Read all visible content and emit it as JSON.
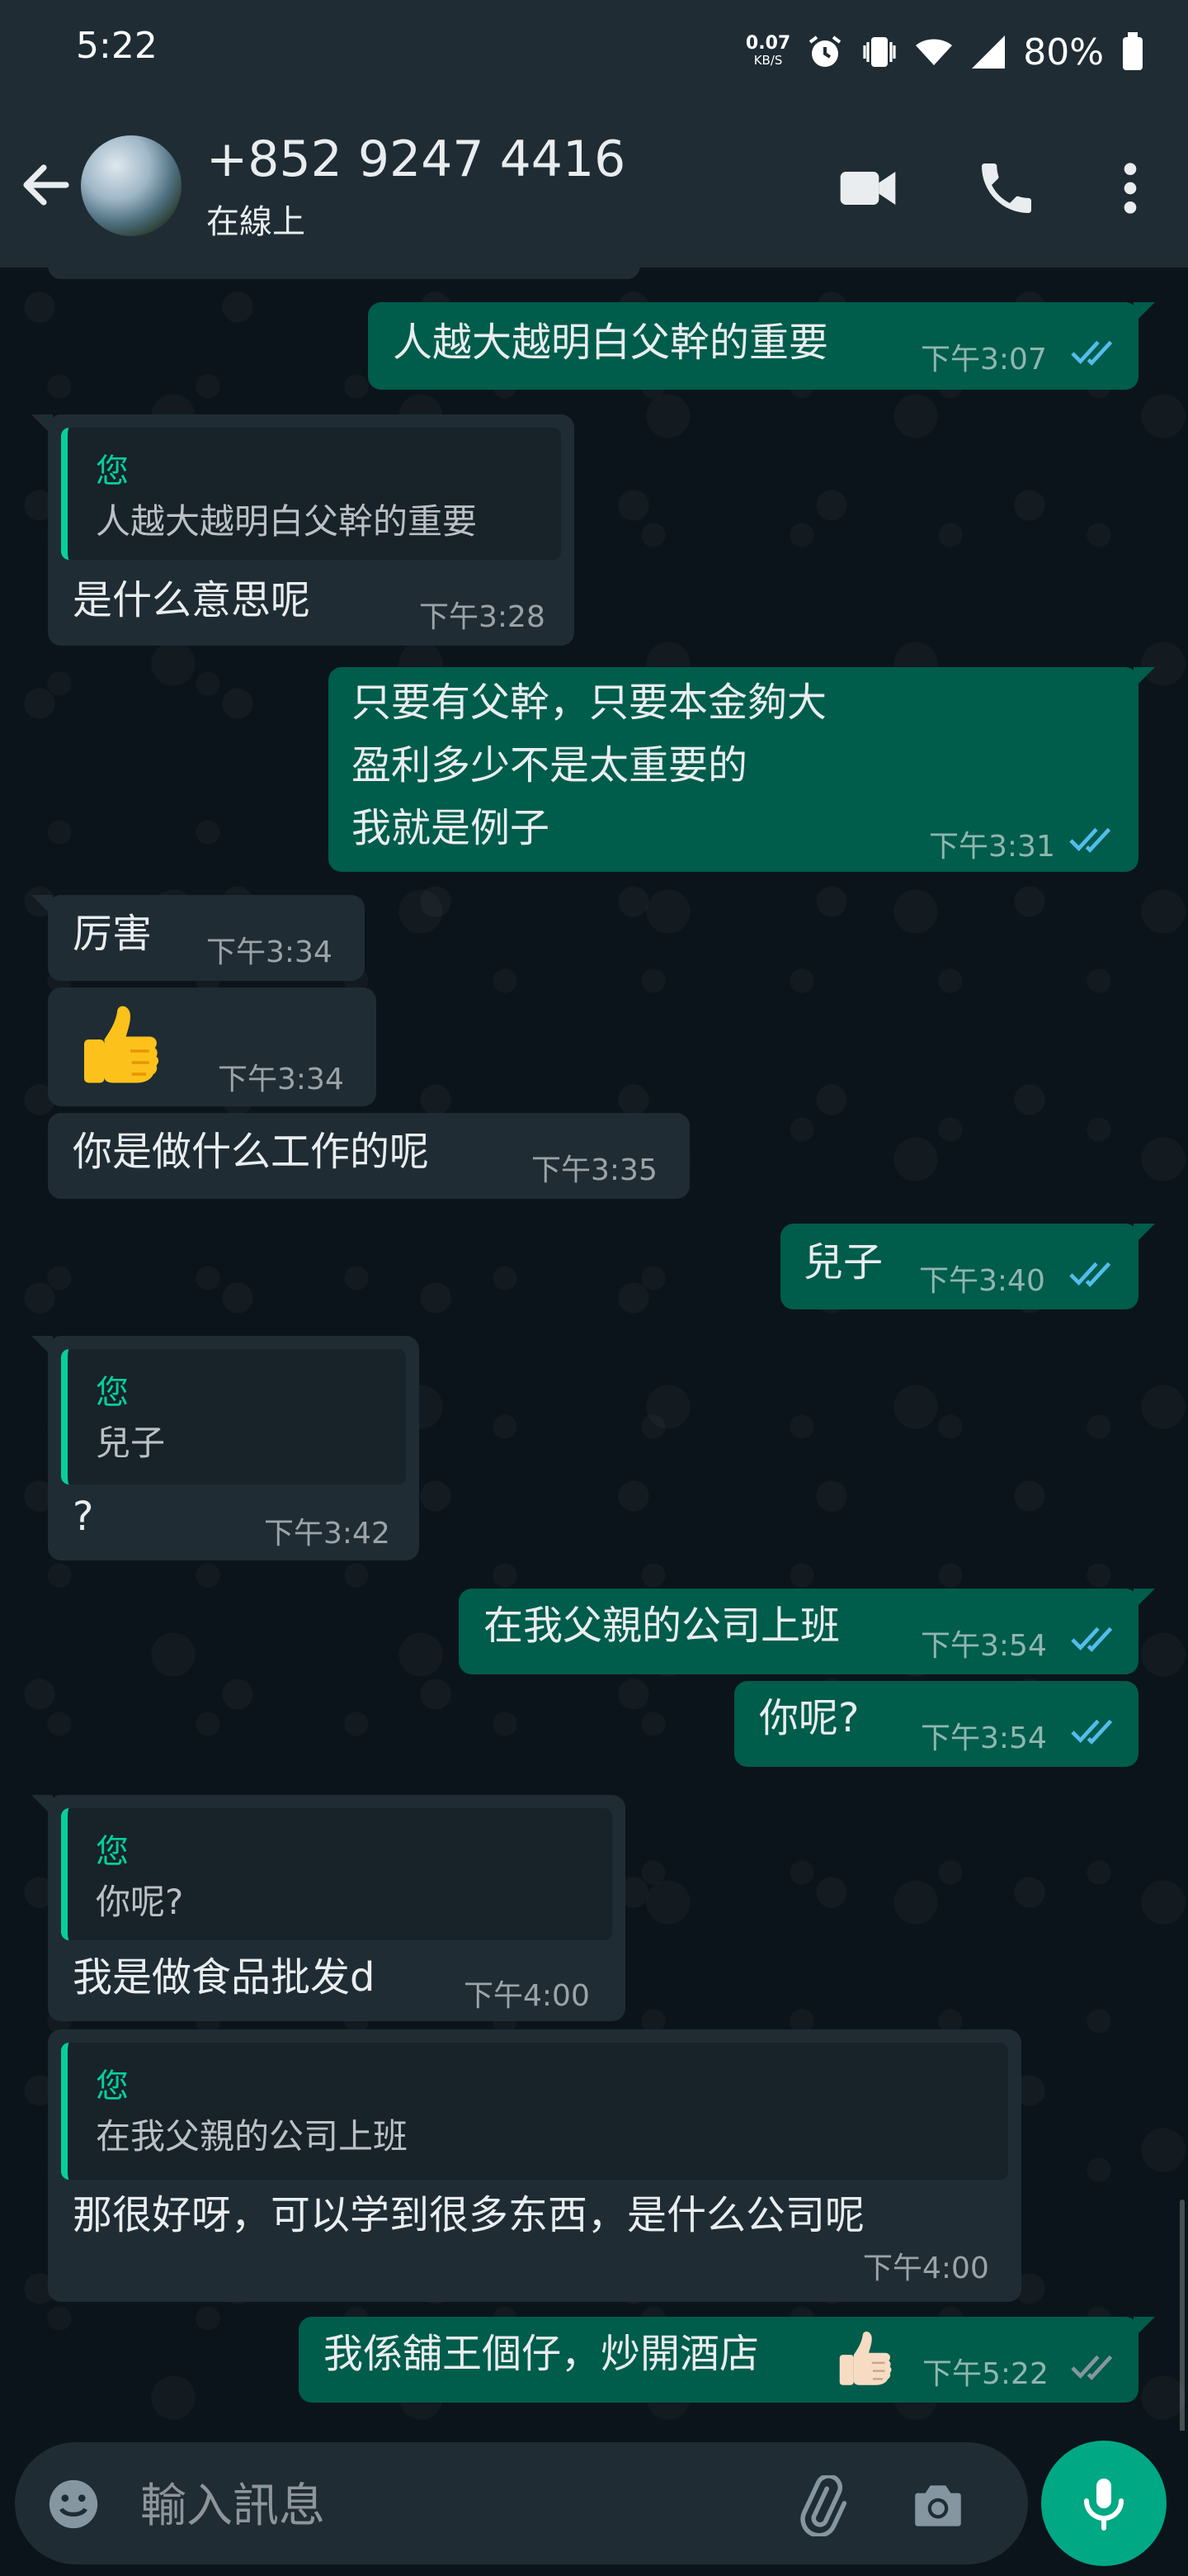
{
  "status_bar": {
    "time": "5:22",
    "net_speed": "0.07",
    "net_unit": "KB/S",
    "battery": "80%"
  },
  "header": {
    "contact_name": "+852 9247 4416",
    "contact_status": "在線上"
  },
  "messages": [
    {
      "dir": "out",
      "text": "人越大越明白父幹的重要",
      "time": "下午3:07",
      "read": true
    },
    {
      "dir": "in",
      "quote": {
        "author": "您",
        "text": "人越大越明白父幹的重要"
      },
      "text": "是什么意思呢",
      "time": "下午3:28"
    },
    {
      "dir": "out",
      "lines": [
        "只要有父幹，只要本金夠大",
        "盈利多少不是太重要的",
        "我就是例子"
      ],
      "time": "下午3:31",
      "read": true
    },
    {
      "dir": "in",
      "text": "厉害",
      "time": "下午3:34"
    },
    {
      "dir": "in",
      "emoji": "thumbs-up",
      "time": "下午3:34"
    },
    {
      "dir": "in",
      "text": "你是做什么工作的呢",
      "time": "下午3:35"
    },
    {
      "dir": "out",
      "text": "兒子",
      "time": "下午3:40",
      "read": true
    },
    {
      "dir": "in",
      "quote": {
        "author": "您",
        "text": "兒子"
      },
      "text": "?",
      "time": "下午3:42"
    },
    {
      "dir": "out",
      "text": "在我父親的公司上班",
      "time": "下午3:54",
      "read": true
    },
    {
      "dir": "out",
      "text": "你呢?",
      "time": "下午3:54",
      "read": true
    },
    {
      "dir": "in",
      "quote": {
        "author": "您",
        "text": "你呢?"
      },
      "text": "我是做食品批发d",
      "time": "下午4:00"
    },
    {
      "dir": "in",
      "quote": {
        "author": "您",
        "text": "在我父親的公司上班"
      },
      "text": "那很好呀，可以学到很多东西，是什么公司呢",
      "time": "下午4:00"
    },
    {
      "dir": "out",
      "text": "我係舖王個仔，炒開酒店",
      "emoji": "thumbs-up-light",
      "time": "下午5:22",
      "read": false
    }
  ],
  "composer": {
    "placeholder": "輸入訊息"
  },
  "colors": {
    "background": "#0b141a",
    "header": "#1f2c34",
    "incoming": "#1f2c34",
    "outgoing": "#005c4b",
    "accent": "#00a884",
    "quote_author": "#06cf9c",
    "read_ticks": "#53bdeb"
  },
  "icons": [
    "back-arrow-icon",
    "avatar",
    "video-call-icon",
    "phone-icon",
    "more-options-icon",
    "emoji-icon",
    "attach-icon",
    "camera-icon",
    "mic-icon",
    "double-check-icon",
    "thumbs-up-emoji"
  ]
}
